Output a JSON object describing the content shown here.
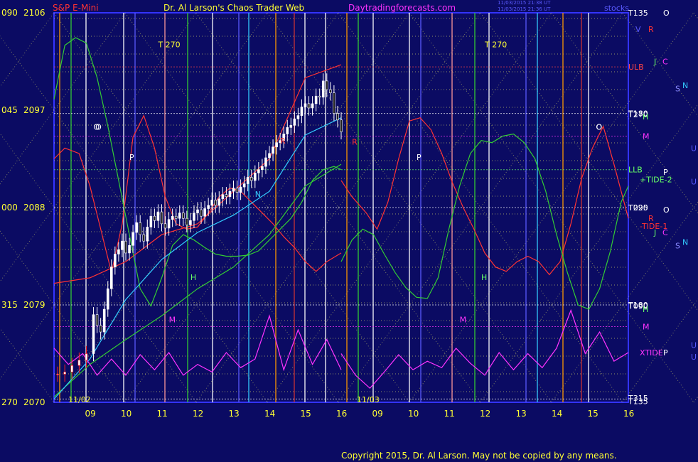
{
  "header": {
    "instrument": "S&P E-Mini",
    "title": "Dr. Al Larson's Chaos Trader Web",
    "website": "Daytradingforecasts.com",
    "timestamp_line1": "11/03/2015 21:38 UT",
    "timestamp_line2": "11/03/2015 21:36 UT",
    "stocks_label": "stocks"
  },
  "footer": {
    "copyright": "Copyright 2015, Dr. Al Larson. May not be copied by any means."
  },
  "chart_data": {
    "type": "line",
    "title": "S&P E-Mini",
    "y_axis": {
      "range": [
        2070,
        2106
      ],
      "ticks": [
        {
          "angle": "090",
          "price": "2106"
        },
        {
          "angle": "045",
          "price": "2097"
        },
        {
          "angle": "000",
          "price": "2088"
        },
        {
          "angle": "315",
          "price": "2079"
        },
        {
          "angle": "270",
          "price": "2070"
        }
      ]
    },
    "x_axis": {
      "range": [
        8,
        16
      ],
      "hour_ticks": [
        "09",
        "10",
        "11",
        "12",
        "13",
        "14",
        "15",
        "16",
        "09",
        "10",
        "11",
        "12",
        "13",
        "14",
        "15",
        "16"
      ],
      "date_labels": [
        "11/02",
        "11/03"
      ],
      "colors": {
        "hour": "#ffff33",
        "date": "#ffff33"
      }
    },
    "right_labels": [
      {
        "text": "T135",
        "color": "#ffffff",
        "price": 2106
      },
      {
        "text": "O",
        "color": "#ffffff",
        "price": 2106
      },
      {
        "text": "R",
        "color": "#ff3333",
        "price": 2104.5
      },
      {
        "text": "V",
        "color": "#5a5aff",
        "price": 2104.5
      },
      {
        "text": "J",
        "color": "#66ff66",
        "price": 2101.5
      },
      {
        "text": "C",
        "color": "#ff33ff",
        "price": 2101.5
      },
      {
        "text": "S",
        "color": "#8888ff",
        "price": 2099
      },
      {
        "text": "N",
        "color": "#33ccff",
        "price": 2099.3
      },
      {
        "text": "ULB",
        "color": "#ff4444",
        "price": 2101
      },
      {
        "text": "T180",
        "color": "#ffffff",
        "price": 2096.7
      },
      {
        "text": "T270",
        "color": "#ffffff",
        "price": 2096.6
      },
      {
        "text": "H",
        "color": "#66ff66",
        "price": 2096.4
      },
      {
        "text": "M",
        "color": "#ff33ff",
        "price": 2094.6
      },
      {
        "text": "U",
        "color": "#5a5aff",
        "price": 2093.5
      },
      {
        "text": "LLB",
        "color": "#66ff66",
        "price": 2091.5
      },
      {
        "text": "P",
        "color": "#ffffff",
        "price": 2091.3
      },
      {
        "text": "+TIDE-2",
        "color": "#66ff66",
        "price": 2090.6
      },
      {
        "text": "T225",
        "color": "#ffffff",
        "price": 2088
      },
      {
        "text": "T090",
        "color": "#ffffff",
        "price": 2088
      },
      {
        "text": "O",
        "color": "#ffffff",
        "price": 2087.8
      },
      {
        "text": "R",
        "color": "#ff3333",
        "price": 2087
      },
      {
        "text": "-TIDE-1",
        "color": "#ff3333",
        "price": 2086.3
      },
      {
        "text": "J",
        "color": "#66ff66",
        "price": 2085.7
      },
      {
        "text": "C",
        "color": "#ff33ff",
        "price": 2085.7
      },
      {
        "text": "S",
        "color": "#8888ff",
        "price": 2084.5
      },
      {
        "text": "N",
        "color": "#33ccff",
        "price": 2084.8
      },
      {
        "text": "T180",
        "color": "#ffffff",
        "price": 2079
      },
      {
        "text": "T090",
        "color": "#ffffff",
        "price": 2078.9
      },
      {
        "text": "H",
        "color": "#66ff66",
        "price": 2078.6
      },
      {
        "text": "M",
        "color": "#ff33ff",
        "price": 2077
      },
      {
        "text": "U",
        "color": "#5a5aff",
        "price": 2075.3
      },
      {
        "text": "XTIDE",
        "color": "#ff33ff",
        "price": 2074.6
      },
      {
        "text": "P",
        "color": "#ffffff",
        "price": 2074.6
      },
      {
        "text": "T315",
        "color": "#ffffff",
        "price": 2070.4
      },
      {
        "text": "T135",
        "color": "#ffffff",
        "price": 2070.1
      },
      {
        "text": "U",
        "color": "#5a5aff",
        "price": 2090.4
      },
      {
        "text": "U",
        "color": "#5a5aff",
        "price": 2074.2
      }
    ],
    "in_chart_labels": [
      {
        "text": "T 270",
        "color": "#ffff33",
        "x": 10.9,
        "y": 2102.8
      },
      {
        "text": "T 270",
        "color": "#ffff33",
        "x": 12.0,
        "y": 2102.8
      },
      {
        "text": "O",
        "color": "#ffffff",
        "x": 9.15,
        "y": 2095.2
      },
      {
        "text": "O",
        "color": "#ffffff",
        "x": 15.1,
        "y": 2095.2
      },
      {
        "text": "O",
        "color": "#ffffff",
        "x": 9.1,
        "y": 2095.2
      },
      {
        "text": "O",
        "color": "#ffffff",
        "x": 15.1,
        "y": 2095.2
      },
      {
        "text": "P",
        "color": "#ffffff",
        "x": 10.1,
        "y": 2092.4
      },
      {
        "text": "P",
        "color": "#ffffff",
        "x": 10.1,
        "y": 2092.4
      },
      {
        "text": "M",
        "color": "#ff33ff",
        "x": 11.2,
        "y": 2077.4
      },
      {
        "text": "M",
        "color": "#ff33ff",
        "x": 11.3,
        "y": 2077.4
      },
      {
        "text": "H",
        "color": "#66ff66",
        "x": 11.8,
        "y": 2081.3
      },
      {
        "text": "H",
        "color": "#66ff66",
        "x": 11.9,
        "y": 2081.3
      },
      {
        "text": "N",
        "color": "#33ccff",
        "x": 13.6,
        "y": 2089.0
      },
      {
        "text": "R",
        "color": "#ff3333",
        "x": 8.3,
        "y": 2093.8
      },
      {
        "text": "R",
        "color": "#ff3333",
        "x": 14.3,
        "y": 2093.9
      }
    ],
    "price_series": {
      "name": "S&P E-Mini bars",
      "color": "#ffffff",
      "x": [
        8.1,
        8.3,
        8.5,
        8.7,
        8.9,
        9.1,
        9.2,
        9.3,
        9.4,
        9.5,
        9.6,
        9.7,
        9.8,
        9.9,
        10.0,
        10.1,
        10.2,
        10.3,
        10.4,
        10.5,
        10.6,
        10.7,
        10.8,
        10.9,
        11.0,
        11.1,
        11.2,
        11.3,
        11.4,
        11.5,
        11.6,
        11.7,
        11.8,
        11.9,
        12.0,
        12.1,
        12.2,
        12.3,
        12.4,
        12.5,
        12.6,
        12.7,
        12.8,
        12.9,
        13.0,
        13.1,
        13.2,
        13.3,
        13.4,
        13.5,
        13.6,
        13.7,
        13.8,
        13.9,
        14.0,
        14.1,
        14.2,
        14.3,
        14.4,
        14.5,
        14.6,
        14.7,
        14.8,
        14.9,
        15.0,
        15.1,
        15.2,
        15.3,
        15.4,
        15.5,
        15.6,
        15.7,
        15.8,
        15.9,
        16.0
      ],
      "y": [
        2072.6,
        2072.8,
        2073.4,
        2073.9,
        2074.5,
        2078.1,
        2077.1,
        2076.5,
        2078.6,
        2080.5,
        2082.5,
        2083.7,
        2084.1,
        2084.9,
        2083.8,
        2084.5,
        2085.7,
        2086.6,
        2085.5,
        2084.9,
        2086.2,
        2087.2,
        2086.8,
        2087.6,
        2086.5,
        2086.1,
        2086.9,
        2087.2,
        2087.0,
        2087.5,
        2087.0,
        2086.4,
        2086.8,
        2087.5,
        2087.8,
        2087.2,
        2087.9,
        2088.2,
        2088.7,
        2088.2,
        2088.8,
        2089.2,
        2089.0,
        2089.5,
        2089.8,
        2089.4,
        2089.9,
        2090.2,
        2090.8,
        2090.5,
        2091.2,
        2091.5,
        2091.8,
        2092.6,
        2093.0,
        2093.6,
        2094.0,
        2094.2,
        2094.8,
        2095.4,
        2095.6,
        2096.2,
        2096.5,
        2097.3,
        2097.6,
        2097.2,
        2097.6,
        2098.3,
        2098.2,
        2099.7,
        2098.9,
        2098.6,
        2096.7,
        2096.1,
        2095.0
      ]
    },
    "series": [
      {
        "name": "red forecast (11/02)",
        "color": "#ff3333",
        "x": [
          8.0,
          8.3,
          8.7,
          9.0,
          9.3,
          9.6,
          9.9,
          10.2,
          10.5,
          10.8,
          11.1,
          11.4,
          11.7,
          12.0,
          12.3,
          12.6,
          12.9,
          13.2,
          13.5,
          13.8,
          14.1,
          14.4,
          14.7,
          15.0,
          15.3,
          15.6,
          16.0
        ],
        "y": [
          2092.5,
          2093.5,
          2093.0,
          2090.0,
          2086.0,
          2082.0,
          2086.5,
          2094.5,
          2096.5,
          2093.5,
          2089.0,
          2086.5,
          2086.0,
          2086.2,
          2087.5,
          2089.0,
          2089.8,
          2089.5,
          2088.5,
          2087.5,
          2086.5,
          2085.3,
          2084.3,
          2083.0,
          2082.1,
          2083.0,
          2083.8
        ]
      },
      {
        "name": "red forecast (11/03)",
        "color": "#ff3333",
        "x": [
          8.0,
          8.3,
          8.7,
          9.0,
          9.3,
          9.6,
          9.9,
          10.2,
          10.5,
          10.8,
          11.1,
          11.4,
          11.7,
          12.0,
          12.3,
          12.6,
          12.9,
          13.2,
          13.5,
          13.8,
          14.1,
          14.4,
          14.7,
          15.0,
          15.3,
          15.6,
          16.0
        ],
        "y": [
          2090.5,
          2089.0,
          2087.5,
          2086.0,
          2088.5,
          2092.5,
          2096.0,
          2096.3,
          2095.2,
          2093.0,
          2090.3,
          2088.0,
          2086.0,
          2083.8,
          2082.5,
          2082.1,
          2083.0,
          2083.5,
          2083.0,
          2081.8,
          2083.0,
          2086.5,
          2090.7,
          2093.5,
          2095.5,
          2092.0,
          2087.0
        ]
      },
      {
        "name": "red rising line",
        "color": "#ff3333",
        "x": [
          8.0,
          9.0,
          10.0,
          11.0,
          12.0,
          13.0,
          14.0,
          15.0,
          16.0
        ],
        "y": [
          2081.0,
          2081.5,
          2083.0,
          2085.5,
          2086.5,
          2089.5,
          2092.5,
          2100.0,
          2101.2
        ]
      },
      {
        "name": "green curve (11/02)",
        "color": "#33cc33",
        "x": [
          8.0,
          8.3,
          8.6,
          8.9,
          9.2,
          9.5,
          9.8,
          10.1,
          10.4,
          10.7,
          11.0,
          11.3,
          11.6,
          11.9,
          12.2,
          12.5,
          12.8,
          13.1,
          13.4,
          13.7,
          14.0,
          14.3,
          14.6,
          14.9,
          15.2,
          15.5,
          15.8,
          16.0
        ],
        "y": [
          2098.0,
          2103.0,
          2103.7,
          2103.2,
          2100.0,
          2095.5,
          2090.5,
          2085.5,
          2080.5,
          2078.9,
          2081.5,
          2084.5,
          2085.5,
          2085.0,
          2084.3,
          2083.7,
          2083.5,
          2083.5,
          2083.6,
          2084.0,
          2085.0,
          2086.0,
          2087.0,
          2088.5,
          2090.5,
          2091.5,
          2091.8,
          2091.5
        ]
      },
      {
        "name": "green curve (11/03)",
        "color": "#33cc33",
        "x": [
          8.0,
          8.3,
          8.6,
          8.9,
          9.2,
          9.5,
          9.8,
          10.1,
          10.4,
          10.7,
          11.0,
          11.3,
          11.6,
          11.9,
          12.2,
          12.5,
          12.8,
          13.1,
          13.4,
          13.7,
          14.0,
          14.3,
          14.6,
          14.9,
          15.2,
          15.5,
          15.8,
          16.0
        ],
        "y": [
          2083.0,
          2085.0,
          2086.0,
          2085.5,
          2083.7,
          2082.0,
          2080.6,
          2079.7,
          2079.6,
          2081.5,
          2086.0,
          2090.0,
          2093.0,
          2094.2,
          2094.0,
          2094.6,
          2094.8,
          2094.0,
          2092.5,
          2089.5,
          2085.5,
          2082.0,
          2079.0,
          2078.6,
          2080.5,
          2084.0,
          2088.5,
          2090.0
        ]
      },
      {
        "name": "green rising line",
        "color": "#33cc33",
        "x": [
          8.0,
          9.0,
          10.0,
          11.0,
          12.0,
          13.0,
          14.0,
          15.0,
          16.0
        ],
        "y": [
          2070.5,
          2073.5,
          2075.8,
          2078.0,
          2080.5,
          2082.5,
          2085.5,
          2090.0,
          2092.0
        ]
      },
      {
        "name": "cyan average",
        "color": "#33ccff",
        "x": [
          8.0,
          9.0,
          10.0,
          11.0,
          12.0,
          13.0,
          14.0,
          15.0,
          16.0
        ],
        "y": [
          2070.3,
          2074.0,
          2079.5,
          2083.2,
          2085.7,
          2087.3,
          2089.5,
          2094.7,
          2096.3
        ]
      },
      {
        "name": "magenta oscillator (11/02)",
        "color": "#ff33ff",
        "x": [
          8.0,
          8.4,
          8.8,
          9.2,
          9.6,
          10.0,
          10.4,
          10.8,
          11.2,
          11.6,
          12.0,
          12.4,
          12.8,
          13.2,
          13.6,
          14.0,
          14.4,
          14.8,
          15.2,
          15.6,
          16.0
        ],
        "y": [
          2075.0,
          2073.5,
          2074.5,
          2072.5,
          2074.0,
          2072.5,
          2074.4,
          2073.0,
          2074.6,
          2072.5,
          2073.5,
          2072.8,
          2074.6,
          2073.2,
          2074.0,
          2078.0,
          2073.0,
          2076.7,
          2073.5,
          2075.8,
          2073.0
        ]
      },
      {
        "name": "magenta oscillator (11/03)",
        "color": "#ff33ff",
        "x": [
          8.0,
          8.4,
          8.8,
          9.2,
          9.6,
          10.0,
          10.4,
          10.8,
          11.2,
          11.6,
          12.0,
          12.4,
          12.8,
          13.2,
          13.6,
          14.0,
          14.4,
          14.8,
          15.2,
          15.6,
          16.0
        ],
        "y": [
          2074.5,
          2072.5,
          2071.3,
          2072.8,
          2074.4,
          2073.0,
          2073.8,
          2073.2,
          2075.0,
          2073.6,
          2072.5,
          2074.6,
          2073.0,
          2074.5,
          2073.2,
          2075.0,
          2078.5,
          2074.5,
          2076.5,
          2073.8,
          2074.6
        ]
      }
    ],
    "gridlines": true,
    "legend": "right-side labels"
  }
}
